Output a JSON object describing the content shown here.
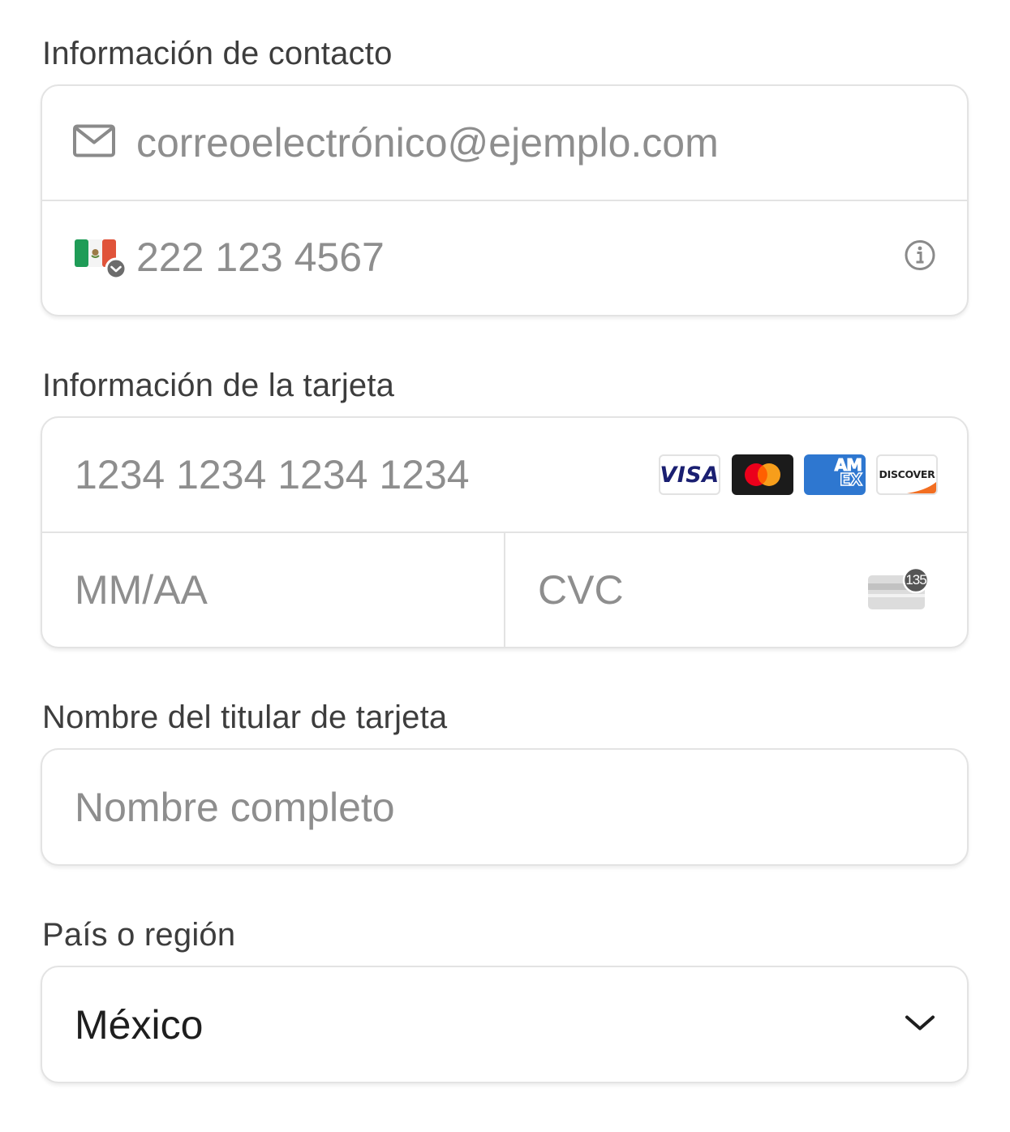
{
  "contact": {
    "label": "Información de contacto",
    "email_placeholder": "correoelectrónico@ejemplo.com",
    "phone_placeholder": "222 123 4567"
  },
  "card": {
    "label": "Información de la tarjeta",
    "number_placeholder": "1234 1234 1234 1234",
    "expiry_placeholder": "MM/AA",
    "cvc_placeholder": "CVC",
    "cvc_badge": "135",
    "brands": {
      "visa": "VISA",
      "amex_top": "AM",
      "amex_bottom": "EX",
      "discover": "DISCOVER"
    }
  },
  "holder": {
    "label": "Nombre del titular de tarjeta",
    "placeholder": "Nombre completo"
  },
  "country": {
    "label": "País o región",
    "value": "México"
  },
  "colors": {
    "border": "#e3e3e3",
    "placeholder": "#8e8e8e",
    "label": "#3d3d3d",
    "visa_blue": "#1a1f71",
    "amex_blue": "#2e77d0",
    "mastercard_red": "#eb001b",
    "mastercard_orange": "#f79e1b",
    "flag_green": "#1f9c57",
    "flag_red": "#e0533a"
  }
}
